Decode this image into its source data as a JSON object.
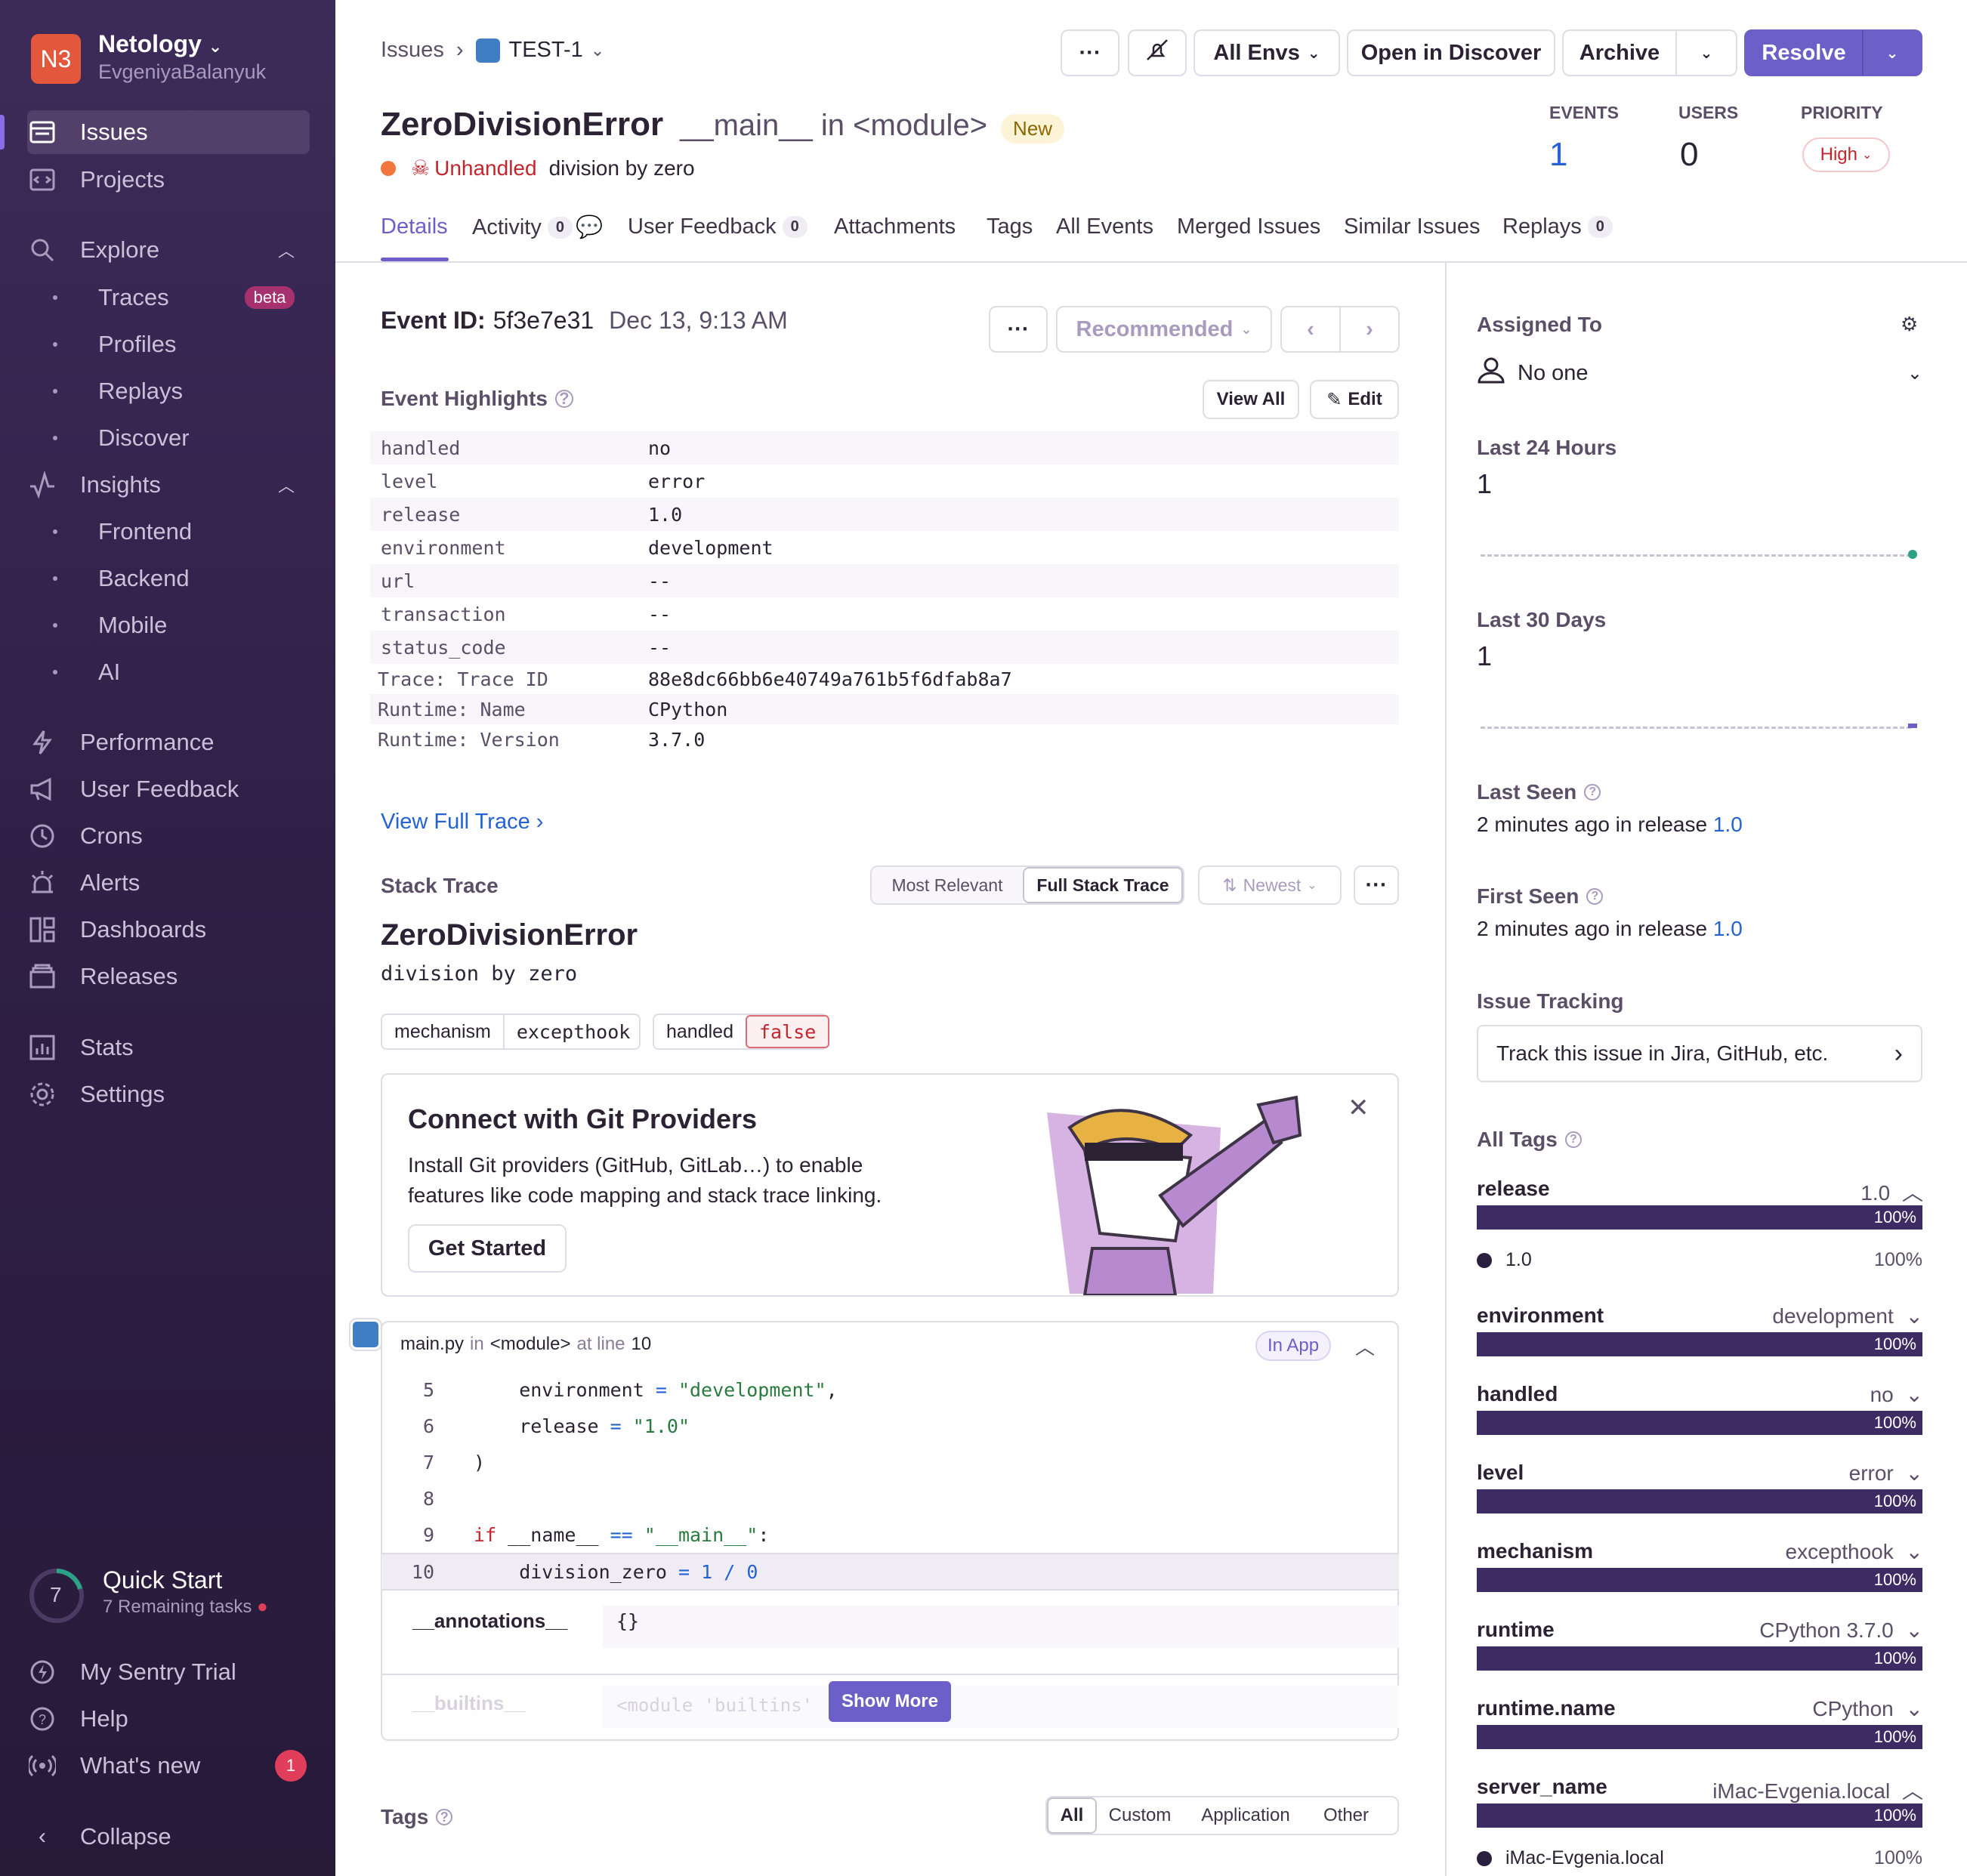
{
  "sidebar": {
    "org_initials": "N3",
    "org_name": "Netology",
    "org_user": "EvgeniyaBalanyuk",
    "items": [
      {
        "label": "Issues"
      },
      {
        "label": "Projects"
      },
      {
        "label": "Explore"
      },
      {
        "label": "Traces",
        "badge": "beta"
      },
      {
        "label": "Profiles"
      },
      {
        "label": "Replays"
      },
      {
        "label": "Discover"
      },
      {
        "label": "Insights"
      },
      {
        "label": "Frontend"
      },
      {
        "label": "Backend"
      },
      {
        "label": "Mobile"
      },
      {
        "label": "AI"
      },
      {
        "label": "Performance"
      },
      {
        "label": "User Feedback"
      },
      {
        "label": "Crons"
      },
      {
        "label": "Alerts"
      },
      {
        "label": "Dashboards"
      },
      {
        "label": "Releases"
      },
      {
        "label": "Stats"
      },
      {
        "label": "Settings"
      }
    ],
    "quick_start": {
      "count": "7",
      "title": "Quick Start",
      "subtitle": "7 Remaining tasks"
    },
    "bottom": [
      {
        "label": "My Sentry Trial"
      },
      {
        "label": "Help"
      },
      {
        "label": "What's new",
        "badge": "1"
      },
      {
        "label": "Collapse"
      }
    ]
  },
  "header": {
    "breadcrumb_root": "Issues",
    "breadcrumb_current": "TEST-1",
    "actions": {
      "more": "···",
      "envs": "All Envs",
      "discover": "Open in Discover",
      "archive": "Archive",
      "resolve": "Resolve"
    },
    "title": "ZeroDivisionError",
    "subtitle_culprit": "__main__ in <module>",
    "status_badge": "New",
    "unhandled": "Unhandled",
    "message": "division by zero",
    "stats": {
      "events_label": "EVENTS",
      "events": "1",
      "users_label": "USERS",
      "users": "0",
      "priority_label": "PRIORITY",
      "priority": "High"
    }
  },
  "tabs": [
    {
      "label": "Details"
    },
    {
      "label": "Activity",
      "count": "0"
    },
    {
      "label": "User Feedback",
      "count": "0"
    },
    {
      "label": "Attachments"
    },
    {
      "label": "Tags"
    },
    {
      "label": "All Events"
    },
    {
      "label": "Merged Issues"
    },
    {
      "label": "Similar Issues"
    },
    {
      "label": "Replays",
      "count": "0"
    }
  ],
  "event": {
    "id_label": "Event ID:",
    "id": "5f3e7e31",
    "date": "Dec 13, 9:13 AM",
    "recommended": "Recommended",
    "highlights_title": "Event Highlights",
    "view_all": "View All",
    "edit": "Edit",
    "highlights": [
      {
        "k": "handled",
        "v": "no"
      },
      {
        "k": "level",
        "v": "error"
      },
      {
        "k": "release",
        "v": "1.0"
      },
      {
        "k": "environment",
        "v": "development"
      },
      {
        "k": "url",
        "v": "--"
      },
      {
        "k": "transaction",
        "v": "--"
      },
      {
        "k": "status_code",
        "v": "--"
      },
      {
        "k": "Trace: Trace ID",
        "v": "88e8dc66bb6e40749a761b5f6dfab8a7"
      },
      {
        "k": "Runtime: Name",
        "v": "CPython"
      },
      {
        "k": "Runtime: Version",
        "v": "3.7.0"
      }
    ],
    "view_full_trace": "View Full Trace"
  },
  "stack": {
    "title": "Stack Trace",
    "toggle_relevant": "Most Relevant",
    "toggle_full": "Full Stack Trace",
    "sort": "Newest",
    "exception_type": "ZeroDivisionError",
    "exception_value": "division by zero",
    "mech_key": "mechanism",
    "mech_val": "excepthook",
    "handled_key": "handled",
    "handled_val": "false"
  },
  "git_promo": {
    "title": "Connect with Git Providers",
    "body_line1": "Install Git providers (GitHub, GitLab…) to enable",
    "body_line2": "features like code mapping and stack trace linking.",
    "cta": "Get Started"
  },
  "frame": {
    "file": "main.py",
    "in": "in",
    "func": "<module>",
    "at_line": "at line",
    "line": "10",
    "in_app": "In App",
    "lines": [
      {
        "n": "5",
        "code": "    environment = \"development\","
      },
      {
        "n": "6",
        "code": "    release = \"1.0\""
      },
      {
        "n": "7",
        "code": ")"
      },
      {
        "n": "8",
        "code": ""
      },
      {
        "n": "9",
        "code": "if __name__ == \"__main__\":"
      },
      {
        "n": "10",
        "code": "    division_zero = 1 / 0"
      }
    ],
    "vars": [
      {
        "k": "__annotations__",
        "v": "{}"
      },
      {
        "k": "__builtins__",
        "v": "<module 'builtins'"
      }
    ],
    "show_more": "Show More"
  },
  "tags_section": {
    "title": "Tags",
    "filters": [
      "All",
      "Custom",
      "Application",
      "Other"
    ]
  },
  "right": {
    "assigned_label": "Assigned To",
    "assignee": "No one",
    "last24_label": "Last 24 Hours",
    "last24": "1",
    "last30_label": "Last 30 Days",
    "last30": "1",
    "last_seen_label": "Last Seen",
    "last_seen": "2 minutes ago",
    "first_seen_label": "First Seen",
    "first_seen": "2 minutes ago",
    "in_release": "in release",
    "release": "1.0",
    "tracking_label": "Issue Tracking",
    "tracking_cta": "Track this issue in Jira, GitHub, etc.",
    "all_tags_label": "All Tags",
    "tags": [
      {
        "name": "release",
        "value": "1.0",
        "pct": "100%",
        "legend": "1.0"
      },
      {
        "name": "environment",
        "value": "development",
        "pct": "100%"
      },
      {
        "name": "handled",
        "value": "no",
        "pct": "100%"
      },
      {
        "name": "level",
        "value": "error",
        "pct": "100%"
      },
      {
        "name": "mechanism",
        "value": "excepthook",
        "pct": "100%"
      },
      {
        "name": "runtime",
        "value": "CPython 3.7.0",
        "pct": "100%"
      },
      {
        "name": "runtime.name",
        "value": "CPython",
        "pct": "100%"
      },
      {
        "name": "server_name",
        "value": "iMac-Evgenia.local",
        "pct": "100%",
        "legend": "iMac-Evgenia.local"
      }
    ]
  },
  "colors": {
    "accent": "#6c5fc7",
    "sidebar": "#2f1f45",
    "link": "#2562d4",
    "error": "#e3573d",
    "bar": "#3f2b63"
  }
}
